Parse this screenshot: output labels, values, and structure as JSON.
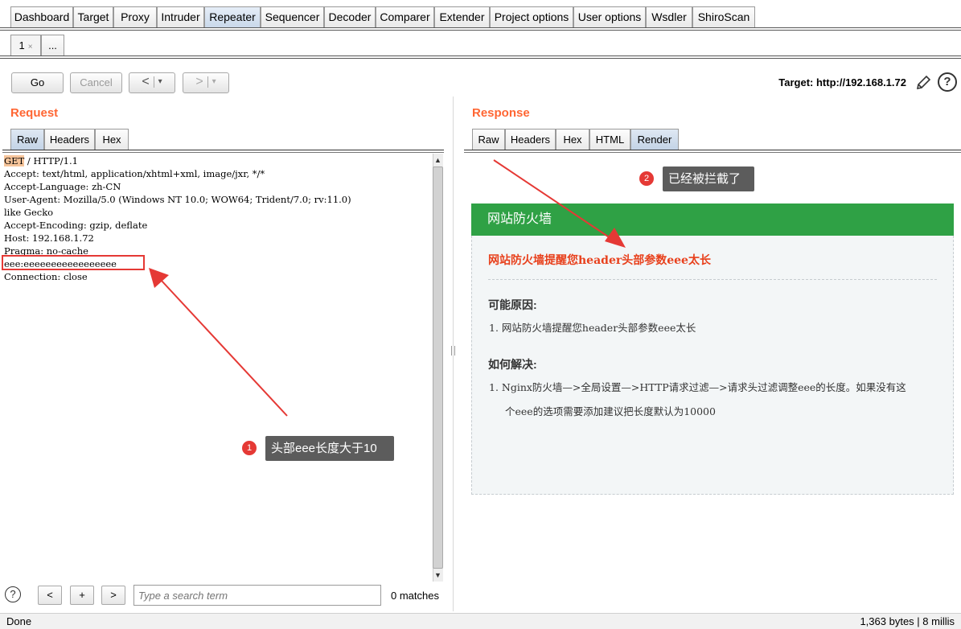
{
  "top_tabs": [
    {
      "label": "Dashboard",
      "active": false
    },
    {
      "label": "Target",
      "active": false
    },
    {
      "label": "Proxy",
      "active": false
    },
    {
      "label": "Intruder",
      "active": false
    },
    {
      "label": "Repeater",
      "active": true
    },
    {
      "label": "Sequencer",
      "active": false
    },
    {
      "label": "Decoder",
      "active": false
    },
    {
      "label": "Comparer",
      "active": false
    },
    {
      "label": "Extender",
      "active": false
    },
    {
      "label": "Project options",
      "active": false
    },
    {
      "label": "User options",
      "active": false
    },
    {
      "label": "Wsdler",
      "active": false
    },
    {
      "label": "ShiroScan",
      "active": false
    }
  ],
  "repeater_tabs": {
    "tab1": "1",
    "tab1_close": "×",
    "more": "..."
  },
  "toolbar": {
    "go": "Go",
    "cancel": "Cancel",
    "back": "<",
    "forward": ">",
    "dropdown": "▾",
    "target": "Target: http://192.168.1.72",
    "help": "?"
  },
  "request": {
    "title": "Request",
    "tabs": [
      "Raw",
      "Headers",
      "Hex"
    ],
    "active_tab": "Raw",
    "method": "GET",
    "lines": [
      " / HTTP/1.1",
      "Accept: text/html, application/xhtml+xml, image/jxr, */*",
      "Accept-Language: zh-CN",
      "User-Agent: Mozilla/5.0 (Windows NT 10.0; WOW64; Trident/7.0; rv:11.0)",
      "like Gecko",
      "Accept-Encoding: gzip, deflate",
      "Host: 192.168.1.72",
      "Pragma: no-cache",
      "eee:eeeeeeeeeeeeeeeee",
      "Connection: close"
    ]
  },
  "response": {
    "title": "Response",
    "tabs": [
      "Raw",
      "Headers",
      "Hex",
      "HTML",
      "Render"
    ],
    "active_tab": "Render",
    "render": {
      "header": "网站防火墙",
      "alert": "网站防火墙提醒您header头部参数eee太长",
      "reason_title": "可能原因:",
      "reasons": [
        "1.  网站防火墙提醒您header头部参数eee太长"
      ],
      "fix_title": "如何解决:",
      "fix_line1": "1.  Nginx防火墙—>全局设置—>HTTP请求过滤—>请求头过滤调整eee的长度。如果没有这",
      "fix_line2": "个eee的选项需要添加建议把长度默认为10000"
    }
  },
  "annotations": {
    "callout1_num": "1",
    "callout1_text": "头部eee长度大于10",
    "callout2_num": "2",
    "callout2_text": "已经被拦截了",
    "color": "#e53935"
  },
  "search": {
    "help": "?",
    "prev": "<",
    "add": "+",
    "next": ">",
    "placeholder": "Type a search term",
    "matches": "0 matches"
  },
  "status": {
    "left": "Done",
    "right": "1,363 bytes | 8 millis"
  },
  "colors": {
    "section_title": "#ff6633",
    "waf_green": "#2fa145",
    "waf_alert": "#e8401c"
  }
}
